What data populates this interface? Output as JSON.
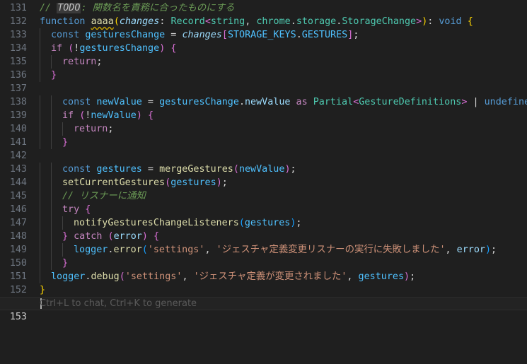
{
  "editor": {
    "colors": {
      "background": "#1f1f1f",
      "keyword": "#569cd6",
      "control": "#c586c0",
      "function": "#dcdcaa",
      "type": "#4ec9b0",
      "variable": "#9cdcfe",
      "constant": "#4fc1ff",
      "string": "#ce9178",
      "comment": "#6a9955",
      "text": "#d4d4d4",
      "bracket_gold": "#ffd700",
      "bracket_pink": "#da70d6",
      "bracket_blue": "#179fff"
    },
    "lines": [
      {
        "number": "131",
        "indent": 0,
        "tokens": [
          {
            "t": "// ",
            "c": "#6a9955",
            "i": true
          },
          {
            "t": "TODO",
            "c": "#c0c0c0",
            "i": true,
            "cls": "todo-badge"
          },
          {
            "t": ": 関数名を責務に合ったものにする",
            "c": "#6a9955",
            "i": true
          }
        ]
      },
      {
        "number": "132",
        "indent": 0,
        "tokens": [
          {
            "t": "function ",
            "c": "#569cd6"
          },
          {
            "t": "aaaa",
            "c": "#dcdcaa",
            "cls": "squiggle"
          },
          {
            "t": "(",
            "c": "#ffd700"
          },
          {
            "t": "changes",
            "c": "#9cdcfe",
            "i": true
          },
          {
            "t": ": ",
            "c": "#d4d4d4"
          },
          {
            "t": "Record",
            "c": "#4ec9b0"
          },
          {
            "t": "<",
            "c": "#da70d6"
          },
          {
            "t": "string",
            "c": "#4ec9b0"
          },
          {
            "t": ", ",
            "c": "#d4d4d4"
          },
          {
            "t": "chrome",
            "c": "#4ec9b0"
          },
          {
            "t": ".",
            "c": "#d4d4d4"
          },
          {
            "t": "storage",
            "c": "#4ec9b0"
          },
          {
            "t": ".",
            "c": "#d4d4d4"
          },
          {
            "t": "StorageChange",
            "c": "#4ec9b0"
          },
          {
            "t": ">",
            "c": "#da70d6"
          },
          {
            "t": ")",
            "c": "#ffd700"
          },
          {
            "t": ": ",
            "c": "#d4d4d4"
          },
          {
            "t": "void",
            "c": "#569cd6"
          },
          {
            "t": " ",
            "c": "#d4d4d4"
          },
          {
            "t": "{",
            "c": "#ffd700"
          }
        ]
      },
      {
        "number": "133",
        "indent": 1,
        "tokens": [
          {
            "t": "const ",
            "c": "#569cd6"
          },
          {
            "t": "gesturesChange",
            "c": "#4fc1ff"
          },
          {
            "t": " = ",
            "c": "#d4d4d4"
          },
          {
            "t": "changes",
            "c": "#9cdcfe",
            "i": true
          },
          {
            "t": "[",
            "c": "#da70d6"
          },
          {
            "t": "STORAGE_KEYS",
            "c": "#4fc1ff"
          },
          {
            "t": ".",
            "c": "#d4d4d4"
          },
          {
            "t": "GESTURES",
            "c": "#4fc1ff"
          },
          {
            "t": "]",
            "c": "#da70d6"
          },
          {
            "t": ";",
            "c": "#d4d4d4"
          }
        ]
      },
      {
        "number": "134",
        "indent": 1,
        "tokens": [
          {
            "t": "if ",
            "c": "#c586c0"
          },
          {
            "t": "(",
            "c": "#da70d6"
          },
          {
            "t": "!",
            "c": "#d4d4d4"
          },
          {
            "t": "gesturesChange",
            "c": "#4fc1ff"
          },
          {
            "t": ") ",
            "c": "#da70d6"
          },
          {
            "t": "{",
            "c": "#da70d6"
          }
        ]
      },
      {
        "number": "135",
        "indent": 2,
        "tokens": [
          {
            "t": "return",
            "c": "#c586c0"
          },
          {
            "t": ";",
            "c": "#d4d4d4"
          }
        ]
      },
      {
        "number": "136",
        "indent": 1,
        "tokens": [
          {
            "t": "}",
            "c": "#da70d6"
          }
        ]
      },
      {
        "number": "137",
        "indent": 0,
        "tokens": []
      },
      {
        "number": "138",
        "indent": 2,
        "tokens": [
          {
            "t": "const ",
            "c": "#569cd6"
          },
          {
            "t": "newValue",
            "c": "#4fc1ff"
          },
          {
            "t": " = ",
            "c": "#d4d4d4"
          },
          {
            "t": "gesturesChange",
            "c": "#4fc1ff"
          },
          {
            "t": ".",
            "c": "#d4d4d4"
          },
          {
            "t": "newValue",
            "c": "#9cdcfe"
          },
          {
            "t": " as ",
            "c": "#c586c0"
          },
          {
            "t": "Partial",
            "c": "#4ec9b0"
          },
          {
            "t": "<",
            "c": "#da70d6"
          },
          {
            "t": "GestureDefinitions",
            "c": "#4ec9b0"
          },
          {
            "t": ">",
            "c": "#da70d6"
          },
          {
            "t": " | ",
            "c": "#d4d4d4"
          },
          {
            "t": "undefined",
            "c": "#569cd6"
          },
          {
            "t": ";",
            "c": "#d4d4d4"
          }
        ]
      },
      {
        "number": "139",
        "indent": 2,
        "tokens": [
          {
            "t": "if ",
            "c": "#c586c0"
          },
          {
            "t": "(",
            "c": "#da70d6"
          },
          {
            "t": "!",
            "c": "#d4d4d4"
          },
          {
            "t": "newValue",
            "c": "#4fc1ff"
          },
          {
            "t": ") ",
            "c": "#da70d6"
          },
          {
            "t": "{",
            "c": "#da70d6"
          }
        ]
      },
      {
        "number": "140",
        "indent": 3,
        "tokens": [
          {
            "t": "return",
            "c": "#c586c0"
          },
          {
            "t": ";",
            "c": "#d4d4d4"
          }
        ]
      },
      {
        "number": "141",
        "indent": 2,
        "tokens": [
          {
            "t": "}",
            "c": "#da70d6"
          }
        ]
      },
      {
        "number": "142",
        "indent": 0,
        "tokens": []
      },
      {
        "number": "143",
        "indent": 2,
        "tokens": [
          {
            "t": "const ",
            "c": "#569cd6"
          },
          {
            "t": "gestures",
            "c": "#4fc1ff"
          },
          {
            "t": " = ",
            "c": "#d4d4d4"
          },
          {
            "t": "mergeGestures",
            "c": "#dcdcaa"
          },
          {
            "t": "(",
            "c": "#da70d6"
          },
          {
            "t": "newValue",
            "c": "#4fc1ff"
          },
          {
            "t": ")",
            "c": "#da70d6"
          },
          {
            "t": ";",
            "c": "#d4d4d4"
          }
        ]
      },
      {
        "number": "144",
        "indent": 2,
        "tokens": [
          {
            "t": "setCurrentGestures",
            "c": "#dcdcaa"
          },
          {
            "t": "(",
            "c": "#da70d6"
          },
          {
            "t": "gestures",
            "c": "#4fc1ff"
          },
          {
            "t": ")",
            "c": "#da70d6"
          },
          {
            "t": ";",
            "c": "#d4d4d4"
          }
        ]
      },
      {
        "number": "145",
        "indent": 2,
        "tokens": [
          {
            "t": "// リスナーに通知",
            "c": "#6a9955",
            "i": true
          }
        ]
      },
      {
        "number": "146",
        "indent": 2,
        "tokens": [
          {
            "t": "try ",
            "c": "#c586c0"
          },
          {
            "t": "{",
            "c": "#da70d6"
          }
        ]
      },
      {
        "number": "147",
        "indent": 3,
        "tokens": [
          {
            "t": "notifyGesturesChangeListeners",
            "c": "#dcdcaa"
          },
          {
            "t": "(",
            "c": "#179fff"
          },
          {
            "t": "gestures",
            "c": "#4fc1ff"
          },
          {
            "t": ")",
            "c": "#179fff"
          },
          {
            "t": ";",
            "c": "#d4d4d4"
          }
        ]
      },
      {
        "number": "148",
        "indent": 2,
        "tokens": [
          {
            "t": "} ",
            "c": "#da70d6"
          },
          {
            "t": "catch ",
            "c": "#c586c0"
          },
          {
            "t": "(",
            "c": "#da70d6"
          },
          {
            "t": "error",
            "c": "#9cdcfe"
          },
          {
            "t": ") ",
            "c": "#da70d6"
          },
          {
            "t": "{",
            "c": "#da70d6"
          }
        ]
      },
      {
        "number": "149",
        "indent": 3,
        "tokens": [
          {
            "t": "logger",
            "c": "#4fc1ff"
          },
          {
            "t": ".",
            "c": "#d4d4d4"
          },
          {
            "t": "error",
            "c": "#dcdcaa"
          },
          {
            "t": "(",
            "c": "#179fff"
          },
          {
            "t": "'settings'",
            "c": "#ce9178"
          },
          {
            "t": ", ",
            "c": "#d4d4d4"
          },
          {
            "t": "'ジェスチャ定義変更リスナーの実行に失敗しました'",
            "c": "#ce9178"
          },
          {
            "t": ", ",
            "c": "#d4d4d4"
          },
          {
            "t": "error",
            "c": "#9cdcfe"
          },
          {
            "t": ")",
            "c": "#179fff"
          },
          {
            "t": ";",
            "c": "#d4d4d4"
          }
        ]
      },
      {
        "number": "150",
        "indent": 2,
        "tokens": [
          {
            "t": "}",
            "c": "#da70d6"
          }
        ]
      },
      {
        "number": "151",
        "indent": 1,
        "tokens": [
          {
            "t": "logger",
            "c": "#4fc1ff"
          },
          {
            "t": ".",
            "c": "#d4d4d4"
          },
          {
            "t": "debug",
            "c": "#dcdcaa"
          },
          {
            "t": "(",
            "c": "#da70d6"
          },
          {
            "t": "'settings'",
            "c": "#ce9178"
          },
          {
            "t": ", ",
            "c": "#d4d4d4"
          },
          {
            "t": "'ジェスチャ定義が変更されました'",
            "c": "#ce9178"
          },
          {
            "t": ", ",
            "c": "#d4d4d4"
          },
          {
            "t": "gestures",
            "c": "#4fc1ff"
          },
          {
            "t": ")",
            "c": "#da70d6"
          },
          {
            "t": ";",
            "c": "#d4d4d4"
          }
        ]
      },
      {
        "number": "152",
        "indent": 0,
        "tokens": [
          {
            "t": "}",
            "c": "#ffd700"
          }
        ]
      }
    ],
    "current_line": {
      "number": "153",
      "hint": "Ctrl+L to chat, Ctrl+K to generate"
    }
  }
}
